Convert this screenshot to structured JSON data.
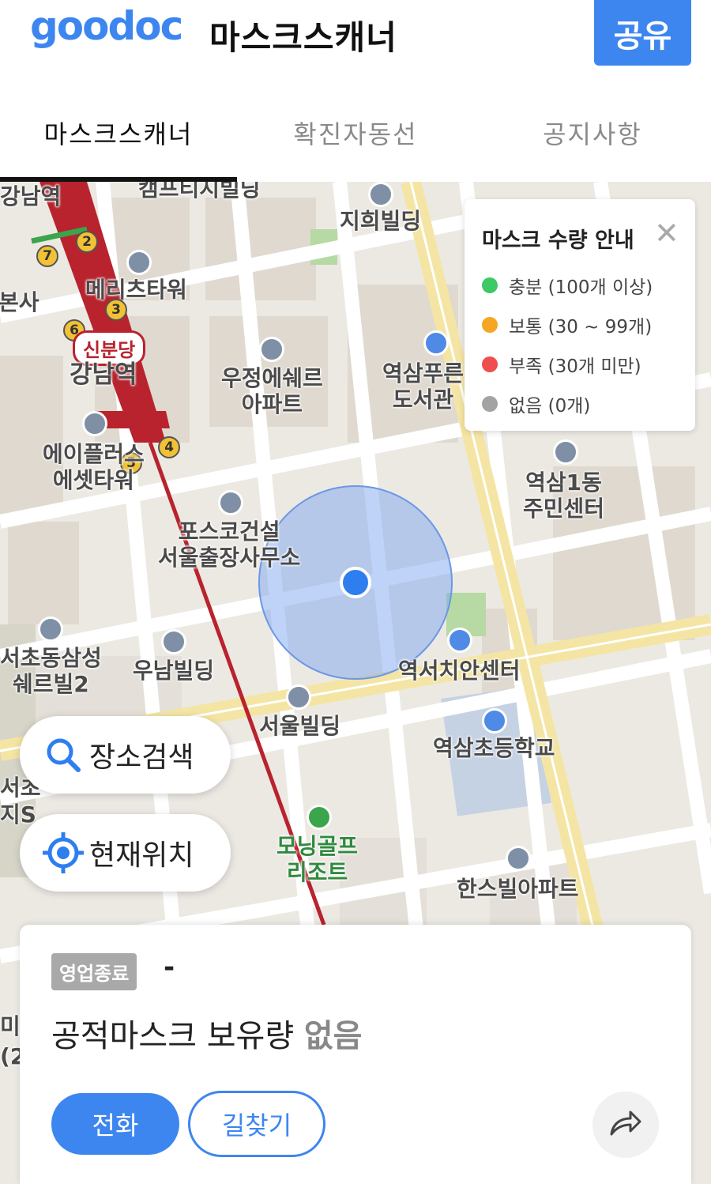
{
  "header": {
    "logo": "goodoc",
    "title": "마스크스캐너",
    "share_label": "공유"
  },
  "tabs": [
    {
      "label": "마스크스캐너",
      "active": true
    },
    {
      "label": "확진자동선",
      "active": false
    },
    {
      "label": "공지사항",
      "active": false
    }
  ],
  "legend": {
    "title": "마스크 수량 안내",
    "items": [
      {
        "label": "충분 (100개 이상)",
        "color": "#3cc966"
      },
      {
        "label": "보통 (30 ~ 99개)",
        "color": "#f5a623"
      },
      {
        "label": "부족 (30개 미만)",
        "color": "#ef4e4e"
      },
      {
        "label": "없음 (0개)",
        "color": "#a3a3a3"
      }
    ]
  },
  "map_labels": {
    "gangnam_top": "강남역",
    "camp": "캠프티지빌딩",
    "jihee": "지희빌딩",
    "meritz": "메리츠타워",
    "bonsa": "본사",
    "sinbundang": "신분당",
    "gangnam": "강남역",
    "woojung": "우정에쉐르\n아파트",
    "yeoksam_library": "역삼푸른\n도서관",
    "aple": "에이플러스\n에셋타워",
    "posco": "포스코건설\n서울출장사무소",
    "yeoksam1": "역삼1동\n주민센터",
    "seocho_samsung": "서초동삼성\n쉐르빌2",
    "unam": "우남빌딩",
    "police": "역서치안센터",
    "seoul_bldg": "서울빌딩",
    "yeoksam_school": "역삼초등학교",
    "morning_golf": "모닝골프\n리조트",
    "hansvill": "한스빌아파트",
    "seoc": "서초",
    "jis": "지S",
    "mi": "미",
    "paren": "(2"
  },
  "float": {
    "search_label": "장소검색",
    "location_label": "현재위치"
  },
  "card": {
    "status": "영업종료",
    "store_name": "-",
    "stock_prefix": "공적마스크 보유량",
    "stock_value": "없음",
    "call_label": "전화",
    "route_label": "길찾기"
  },
  "colors": {
    "accent": "#3d86f0",
    "subway_line": "#b8232d"
  }
}
